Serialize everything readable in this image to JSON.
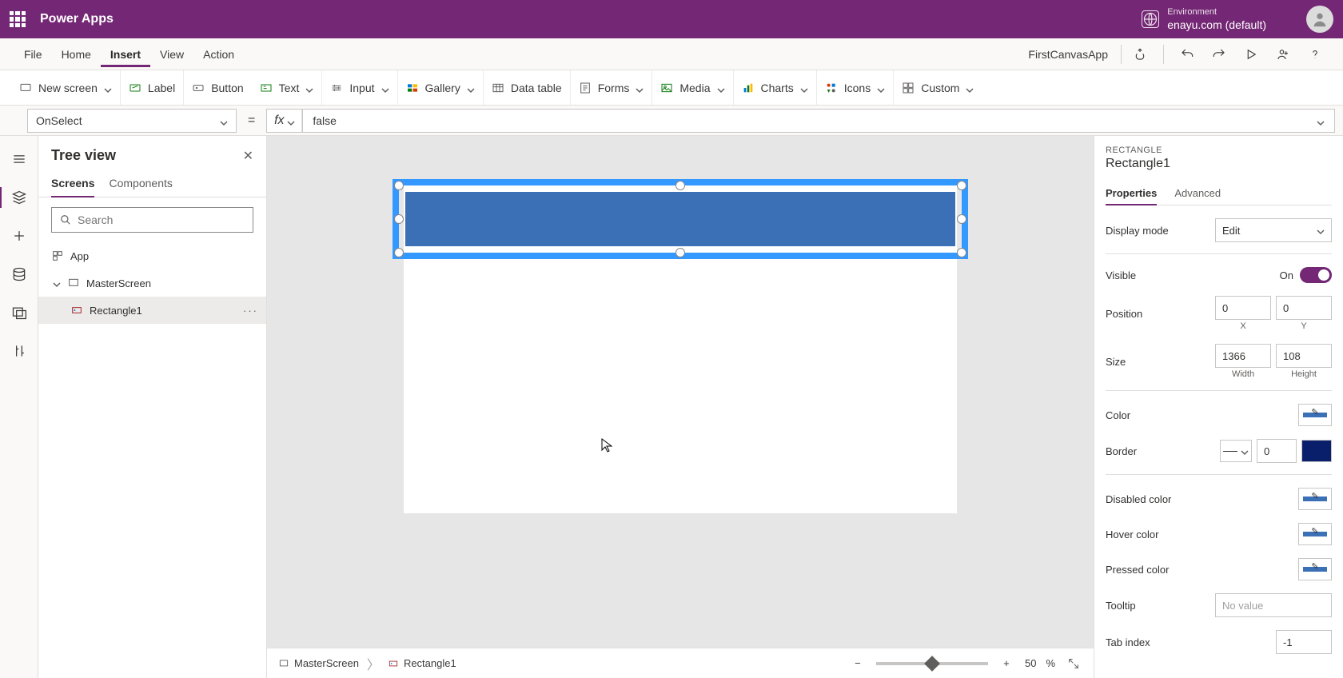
{
  "header": {
    "app_title": "Power Apps",
    "env_label": "Environment",
    "env_name": "enayu.com (default)"
  },
  "menu": {
    "items": [
      "File",
      "Home",
      "Insert",
      "View",
      "Action"
    ],
    "active": "Insert",
    "app_name": "FirstCanvasApp"
  },
  "ribbon": {
    "new_screen": "New screen",
    "label": "Label",
    "button": "Button",
    "text": "Text",
    "input": "Input",
    "gallery": "Gallery",
    "data_table": "Data table",
    "forms": "Forms",
    "media": "Media",
    "charts": "Charts",
    "icons": "Icons",
    "custom": "Custom"
  },
  "formula": {
    "property": "OnSelect",
    "fx": "fx",
    "value": "false"
  },
  "tree": {
    "title": "Tree view",
    "tabs": {
      "screens": "Screens",
      "components": "Components"
    },
    "search_placeholder": "Search",
    "app": "App",
    "screen": "MasterScreen",
    "rect": "Rectangle1"
  },
  "breadcrumb": {
    "screen": "MasterScreen",
    "item": "Rectangle1",
    "zoom": "50",
    "zoom_unit": "%"
  },
  "props": {
    "type": "RECTANGLE",
    "name": "Rectangle1",
    "tabs": {
      "properties": "Properties",
      "advanced": "Advanced"
    },
    "display_mode_label": "Display mode",
    "display_mode_value": "Edit",
    "visible_label": "Visible",
    "visible_on": "On",
    "position_label": "Position",
    "x": "0",
    "y": "0",
    "x_label": "X",
    "y_label": "Y",
    "size_label": "Size",
    "width": "1366",
    "height": "108",
    "width_label": "Width",
    "height_label": "Height",
    "color_label": "Color",
    "border_label": "Border",
    "border_width": "0",
    "disabled_color_label": "Disabled color",
    "hover_color_label": "Hover color",
    "pressed_color_label": "Pressed color",
    "tooltip_label": "Tooltip",
    "tooltip_placeholder": "No value",
    "tabindex_label": "Tab index",
    "tabindex_value": "-1",
    "colors": {
      "fill": "#3b6fb6",
      "border_swatch": "#0a1f6b",
      "disabled": "#3b6fb6",
      "hover": "#3b6fb6",
      "pressed": "#3b6fb6"
    }
  }
}
